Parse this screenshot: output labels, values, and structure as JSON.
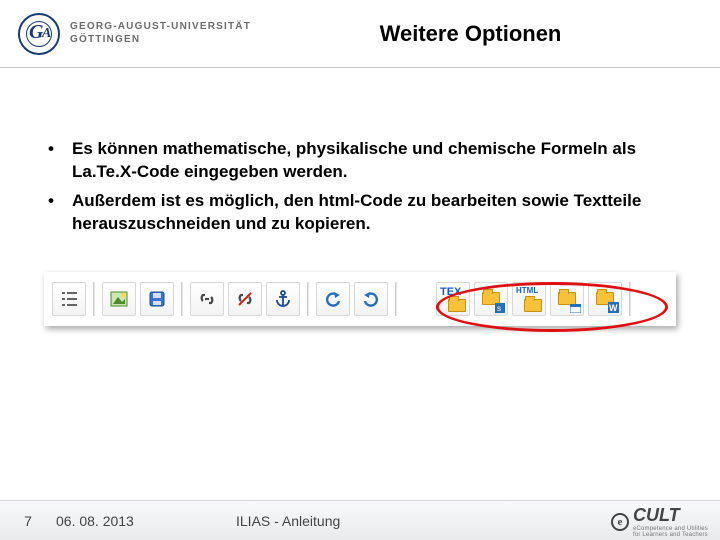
{
  "header": {
    "university_line1": "GEORG-AUGUST-UNIVERSITÄT",
    "university_line2": "GÖTTINGEN",
    "title": "Weitere Optionen"
  },
  "bullets": [
    "Es können mathematische, physikalische und chemische Formeln als La.Te.X-Code eingegeben werden.",
    "Außerdem ist es möglich, den html-Code zu bearbeiten sowie Textteile herauszuschneiden und zu kopieren."
  ],
  "toolbar": {
    "tex_label": "TEX",
    "html_label": "HTML"
  },
  "footer": {
    "page": "7",
    "date": "06. 08. 2013",
    "center": "ILIAS - Anleitung",
    "brand": "CULT",
    "brand_sub1": "eCompetence and Utilities",
    "brand_sub2": "for Learners and Teachers"
  }
}
